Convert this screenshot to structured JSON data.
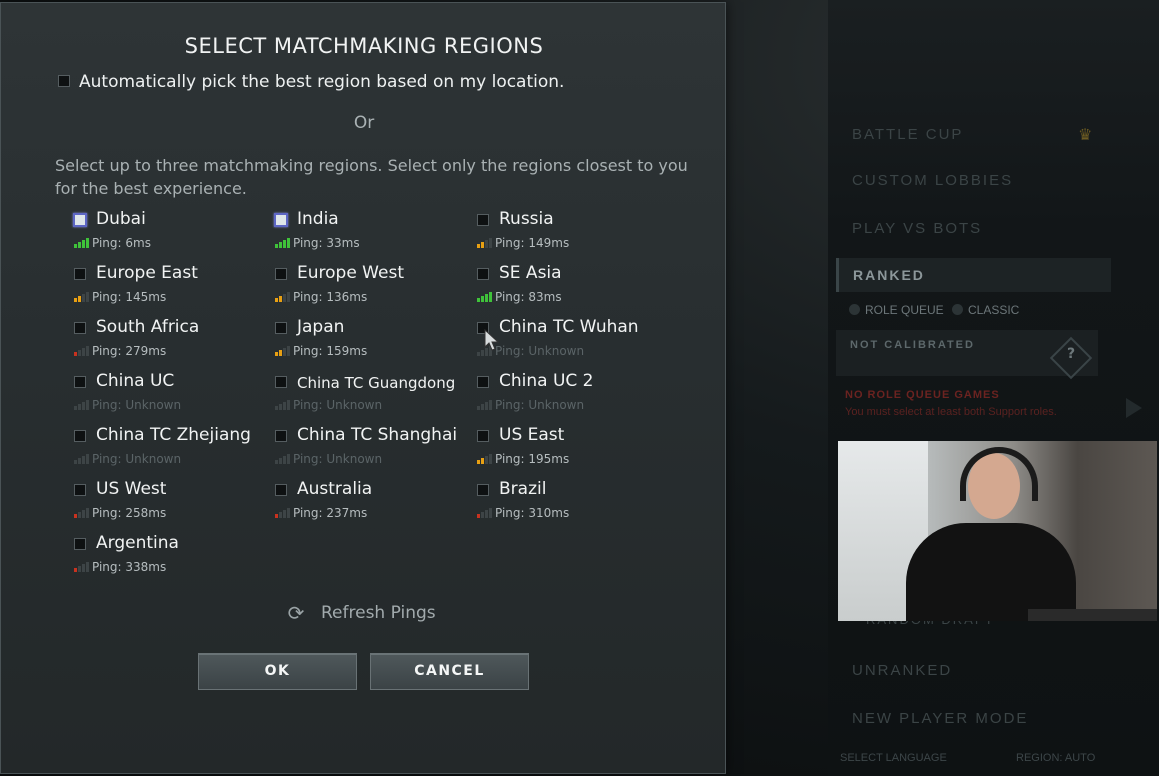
{
  "dialog": {
    "title": "SELECT MATCHMAKING REGIONS",
    "auto_pick_label": "Automatically pick the best region based on my location.",
    "or_text": "Or",
    "instructions": "Select up to three matchmaking regions. Select only the regions closest to you for the best experience.",
    "refresh_label": "Refresh Pings",
    "ok_label": "OK",
    "cancel_label": "CANCEL"
  },
  "colors": {
    "ping_good": "#3fc23a",
    "ping_medium": "#e8a013",
    "ping_bad": "#c8321f",
    "ping_unknown": "#3d4446",
    "checked_border": "#5d66c4"
  },
  "regions": [
    {
      "name": "Dubai",
      "ping": "Ping: 6ms",
      "checked": true,
      "quality": "good"
    },
    {
      "name": "India",
      "ping": "Ping: 33ms",
      "checked": true,
      "quality": "good"
    },
    {
      "name": "Russia",
      "ping": "Ping: 149ms",
      "checked": false,
      "quality": "medium"
    },
    {
      "name": "Europe East",
      "ping": "Ping: 145ms",
      "checked": false,
      "quality": "medium"
    },
    {
      "name": "Europe West",
      "ping": "Ping: 136ms",
      "checked": false,
      "quality": "medium"
    },
    {
      "name": "SE Asia",
      "ping": "Ping: 83ms",
      "checked": false,
      "quality": "good"
    },
    {
      "name": "South Africa",
      "ping": "Ping: 279ms",
      "checked": false,
      "quality": "bad"
    },
    {
      "name": "Japan",
      "ping": "Ping: 159ms",
      "checked": false,
      "quality": "medium"
    },
    {
      "name": "China TC Wuhan",
      "ping": "Ping: Unknown",
      "checked": false,
      "quality": "unknown"
    },
    {
      "name": "China UC",
      "ping": "Ping: Unknown",
      "checked": false,
      "quality": "unknown"
    },
    {
      "name": "China TC Guangdong",
      "ping": "Ping: Unknown",
      "checked": false,
      "quality": "unknown"
    },
    {
      "name": "China UC 2",
      "ping": "Ping: Unknown",
      "checked": false,
      "quality": "unknown"
    },
    {
      "name": "China TC Zhejiang",
      "ping": "Ping: Unknown",
      "checked": false,
      "quality": "unknown"
    },
    {
      "name": "China TC Shanghai",
      "ping": "Ping: Unknown",
      "checked": false,
      "quality": "unknown"
    },
    {
      "name": "US East",
      "ping": "Ping: 195ms",
      "checked": false,
      "quality": "medium"
    },
    {
      "name": "US West",
      "ping": "Ping: 258ms",
      "checked": false,
      "quality": "bad"
    },
    {
      "name": "Australia",
      "ping": "Ping: 237ms",
      "checked": false,
      "quality": "bad"
    },
    {
      "name": "Brazil",
      "ping": "Ping: 310ms",
      "checked": false,
      "quality": "bad"
    },
    {
      "name": "Argentina",
      "ping": "Ping: 338ms",
      "checked": false,
      "quality": "bad"
    }
  ],
  "background_menu": {
    "battle_cup": "BATTLE CUP",
    "custom_lobbies": "CUSTOM LOBBIES",
    "play_vs_bots": "PLAY VS BOTS",
    "ranked": "RANKED",
    "role_queue": "ROLE QUEUE",
    "classic": "CLASSIC",
    "not_calibrated": "NOT CALIBRATED",
    "no_role_queue": "NO ROLE QUEUE GAMES",
    "support_warning": "You must select at least both Support roles.",
    "random_draft": "RANDOM DRAFT",
    "unranked": "UNRANKED",
    "new_player_mode": "NEW PLAYER MODE",
    "select_language": "SELECT LANGUAGE",
    "region": "REGION: AUTO"
  }
}
